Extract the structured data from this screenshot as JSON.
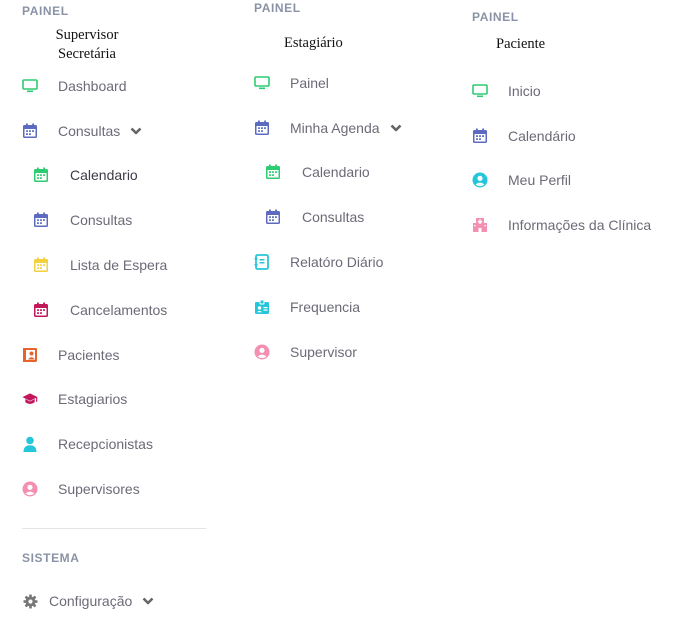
{
  "colors": {
    "green": "#2ecc71",
    "indigo": "#5c6bc0",
    "yellow": "#f4d03f",
    "crimson": "#c2185b",
    "orange": "#e8622c",
    "cyan": "#26c6da",
    "pink": "#f48fb1",
    "gray": "#777777"
  },
  "supervisor": {
    "section_label": "PAINEL",
    "role_line1": "Supervisor",
    "role_line2": "Secretária",
    "items": [
      {
        "label": "Dashboard",
        "icon": "monitor-icon"
      },
      {
        "label": "Consultas",
        "icon": "calendar-icon",
        "expanded": true
      },
      {
        "label": "Calendario",
        "icon": "calendar-icon"
      },
      {
        "label": "Consultas",
        "icon": "calendar-icon"
      },
      {
        "label": "Lista de Espera",
        "icon": "calendar-icon"
      },
      {
        "label": "Cancelamentos",
        "icon": "calendar-icon"
      },
      {
        "label": "Pacientes",
        "icon": "patient-card-icon"
      },
      {
        "label": "Estagiarios",
        "icon": "graduation-cap-icon"
      },
      {
        "label": "Recepcionistas",
        "icon": "person-icon"
      },
      {
        "label": "Supervisores",
        "icon": "user-circle-icon"
      }
    ],
    "system_label": "SISTEMA",
    "config_label": "Configuração"
  },
  "estagiario": {
    "section_label": "PAINEL",
    "role": "Estagiário",
    "items": [
      {
        "label": "Painel",
        "icon": "monitor-icon"
      },
      {
        "label": "Minha Agenda",
        "icon": "calendar-icon",
        "expanded": true
      },
      {
        "label": "Calendario",
        "icon": "calendar-icon"
      },
      {
        "label": "Consultas",
        "icon": "calendar-icon"
      },
      {
        "label": "Relatóro Diário",
        "icon": "report-icon"
      },
      {
        "label": "Frequencia",
        "icon": "id-badge-icon"
      },
      {
        "label": "Supervisor",
        "icon": "user-circle-icon"
      }
    ]
  },
  "paciente": {
    "section_label": "PAINEL",
    "role": "Paciente",
    "items": [
      {
        "label": "Inicio",
        "icon": "monitor-icon"
      },
      {
        "label": "Calendário",
        "icon": "calendar-icon"
      },
      {
        "label": "Meu Perfil",
        "icon": "user-circle-icon"
      },
      {
        "label": "Informações da Clínica",
        "icon": "hospital-icon"
      }
    ]
  }
}
